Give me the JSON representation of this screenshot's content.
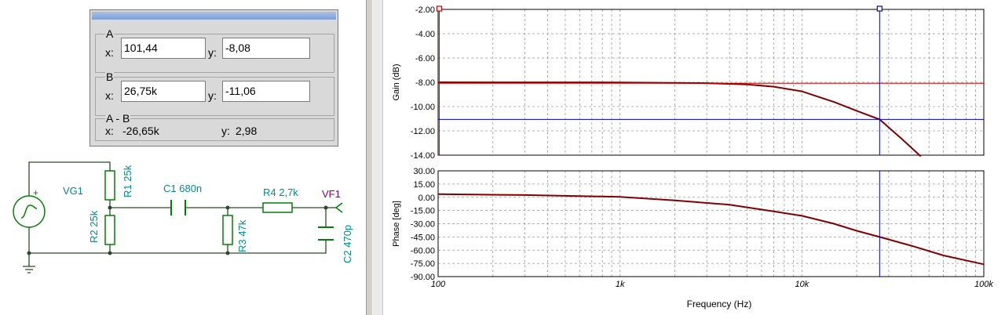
{
  "cursor_panel": {
    "a": {
      "title": "A",
      "x_label": "x:",
      "x_value": "101,44",
      "y_label": "y:",
      "y_value": "-8,08"
    },
    "b": {
      "title": "B",
      "x_label": "x:",
      "x_value": "26,75k",
      "y_label": "y:",
      "y_value": "-11,06"
    },
    "diff": {
      "title": "A - B",
      "x_label": "x:",
      "x_value": "-26,65k",
      "y_label": "y:",
      "y_value": "2,98"
    }
  },
  "schematic": {
    "vg1": "VG1",
    "r1": "R1 25k",
    "r2": "R2 25k",
    "c1": "C1 680n",
    "r3": "R3 47k",
    "r4": "R4 2,7k",
    "vf1": "VF1",
    "c2": "C2 470p",
    "plus": "+",
    "colors": {
      "wire": "#2b4a2b",
      "component": "#008000",
      "label_cyan": "#008b8b",
      "label_purple": "#800080"
    }
  },
  "chart_data": [
    {
      "type": "line",
      "ylabel": "Gain (dB)",
      "xlabel": "Frequency (Hz)",
      "x_scale": "log",
      "xlim": [
        100,
        100000
      ],
      "ylim": [
        -14,
        -2
      ],
      "y_ticks": [
        "-2.00",
        "-4.00",
        "-6.00",
        "-8.00",
        "-10.00",
        "-12.00",
        "-14.00"
      ],
      "x_ticks": [
        "100",
        "1k",
        "10k",
        "100k"
      ],
      "grid": true,
      "series": [
        {
          "x": [
            100,
            1000,
            3000,
            5000,
            7000,
            10000,
            15000,
            20000,
            26750,
            35000,
            45000
          ],
          "values": [
            -8.0,
            -8.01,
            -8.07,
            -8.18,
            -8.36,
            -8.75,
            -9.62,
            -10.35,
            -11.06,
            -12.6,
            -14.1
          ]
        }
      ],
      "cursors": [
        {
          "name": "A",
          "x": 101.44,
          "y": -8.08,
          "color": "#cc0000"
        },
        {
          "name": "B",
          "x": 26750,
          "y": -11.06,
          "color": "#0000cc"
        }
      ],
      "colors": {
        "series": "#800000"
      }
    },
    {
      "type": "line",
      "ylabel": "Phase [deg]",
      "xlabel": "Frequency (Hz)",
      "x_scale": "log",
      "xlim": [
        100,
        100000
      ],
      "ylim": [
        -90,
        30
      ],
      "y_ticks": [
        "30.00",
        "15.00",
        "0.00",
        "-15.00",
        "-30.00",
        "-45.00",
        "-60.00",
        "-75.00",
        "-90.00"
      ],
      "x_ticks": [
        "100",
        "1k",
        "10k",
        "100k"
      ],
      "grid": true,
      "series": [
        {
          "x": [
            100,
            300,
            1000,
            2000,
            4000,
            7000,
            10000,
            15000,
            20000,
            26750,
            40000,
            60000,
            100000
          ],
          "values": [
            3.5,
            2.5,
            0.5,
            -3.5,
            -8.5,
            -16,
            -21,
            -30,
            -38,
            -45,
            -55,
            -66,
            -76
          ]
        }
      ],
      "cursors": [
        {
          "name": "B",
          "x": 26750,
          "color": "#0000cc"
        }
      ],
      "colors": {
        "series": "#800000"
      }
    }
  ]
}
